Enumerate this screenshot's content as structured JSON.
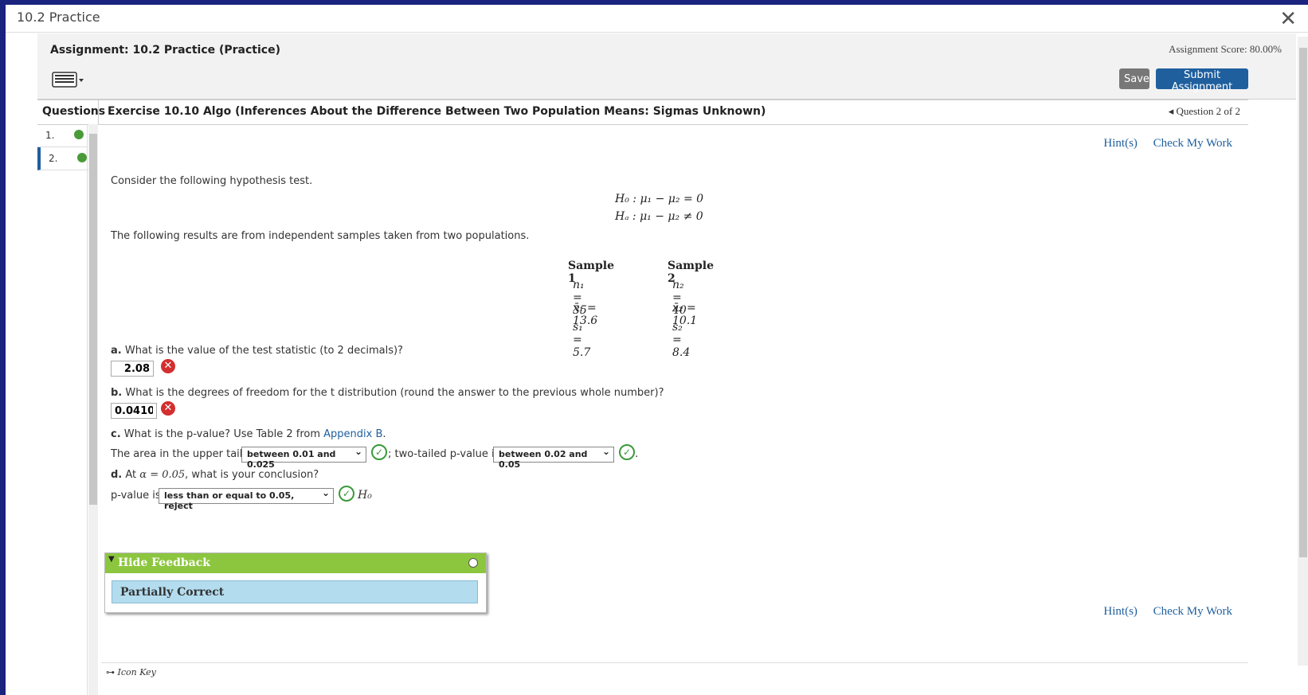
{
  "window": {
    "title": "10.2 Practice"
  },
  "topbar": {
    "assignment_title": "Assignment: 10.2 Practice (Practice)",
    "score": "Assignment Score: 80.00%",
    "save_label": "Save",
    "submit_label": "Submit Assignment"
  },
  "question_header": {
    "questions_label": "Questions",
    "exercise_title": "Exercise 10.10 Algo (Inferences About the Difference Between Two Population Means: Sigmas Unknown)",
    "nav_label": "Question 2 of 2"
  },
  "sidebar": {
    "items": [
      {
        "label": "1."
      },
      {
        "label": "2."
      }
    ]
  },
  "links": {
    "hints": "Hint(s)",
    "check": "Check My Work"
  },
  "problem": {
    "intro": "Consider the following hypothesis test.",
    "h0": "H₀ : μ₁ − μ₂ = 0",
    "ha": "Hₐ : μ₁ − μ₂ ≠ 0",
    "results_text": "The following results are from independent samples taken from two populations.",
    "sample1": {
      "header": "Sample 1",
      "n": "n₁ = 35",
      "xbar": "x̄₁ = 13.6",
      "s": "s₁  = 5.7"
    },
    "sample2": {
      "header": "Sample 2",
      "n": "n₂ = 40",
      "xbar": "x̄₂ = 10.1",
      "s": "s₂  = 8.4"
    }
  },
  "parts": {
    "a": {
      "prefix": "a.",
      "text": " What is the value of the test statistic (to 2 decimals)?",
      "answer": "2.08"
    },
    "b": {
      "prefix": "b.",
      "text": " What is the degrees of freedom for the t distribution (round the answer to the previous whole number)?",
      "answer": "0.0410"
    },
    "c": {
      "prefix": "c.",
      "text": " What is the p-value? Use Table 2 from ",
      "link": "Appendix B",
      "period": ".",
      "line_text1": "The area in the upper tail is",
      "select1": "between 0.01 and 0.025",
      "line_text2": "; two-tailed p-value is",
      "select2": "between 0.02 and 0.05",
      "line_end": "."
    },
    "d": {
      "prefix": "d.",
      "text1": " At ",
      "alpha": "α = 0.05",
      "text2": ", what is your conclusion?",
      "line_text": "p-value is",
      "select": "less than or equal to 0.05, reject",
      "h0": "H₀"
    }
  },
  "feedback": {
    "toggle": "Hide Feedback",
    "result": "Partially Correct"
  },
  "footer": {
    "icon_key": "Icon Key"
  },
  "colors": {
    "accent": "#1f5f9e",
    "feedback_head": "#8cc63f",
    "feedback_body": "#b3dcef",
    "wrong": "#d32f2f",
    "correct": "#3a9a3a"
  }
}
